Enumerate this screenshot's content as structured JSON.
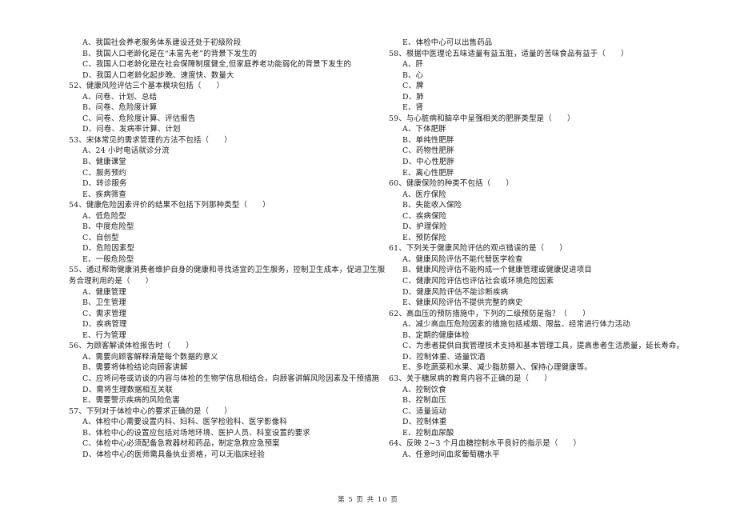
{
  "left_column": [
    {
      "type": "opt",
      "text": "A、我国社会养老服务体系建设还处于初级阶段"
    },
    {
      "type": "opt",
      "text": "B、我国人口老龄化是在“未富先老”的背景下发生的"
    },
    {
      "type": "opt",
      "text": "C、我国人口老龄化是在社会保障制度健全,但家庭养老功能弱化的背景下发生的"
    },
    {
      "type": "opt",
      "text": "D、我国人口老龄化起步晚、速度快、数量大"
    },
    {
      "type": "q",
      "text": "52、健康风险评估三个基本模块包括（　　）"
    },
    {
      "type": "opt",
      "text": "A、问卷、计划、总结"
    },
    {
      "type": "opt",
      "text": "B、问卷、危险度计算"
    },
    {
      "type": "opt",
      "text": "C、问卷、危险度计算、评估报告"
    },
    {
      "type": "opt",
      "text": "D、问卷、发病率计算、计划"
    },
    {
      "type": "q",
      "text": "53、宋体常见的需求管理的方法不包括（　　）"
    },
    {
      "type": "opt",
      "text": "A、24 小时电话就诊分流"
    },
    {
      "type": "opt",
      "text": "B、健康课堂"
    },
    {
      "type": "opt",
      "text": "C、服务预约"
    },
    {
      "type": "opt",
      "text": "D、转诊服务"
    },
    {
      "type": "opt",
      "text": "E、疾病筛查"
    },
    {
      "type": "q",
      "text": "54、健康危险因素评价的结果不包括下列那种类型（　　）"
    },
    {
      "type": "opt",
      "text": "A、低危险型"
    },
    {
      "type": "opt",
      "text": "B、中度危险型"
    },
    {
      "type": "opt",
      "text": "C、自创型"
    },
    {
      "type": "opt",
      "text": "D、危险因素型"
    },
    {
      "type": "opt",
      "text": "E、一般危险型"
    },
    {
      "type": "q",
      "text": "55、通过帮助健康消费者维护自身的健康和寻找适宜的卫生服务，控制卫生成本，促进卫生服"
    },
    {
      "type": "cont",
      "text": "务合理利用的是（　　）"
    },
    {
      "type": "opt",
      "text": "A、健康管理"
    },
    {
      "type": "opt",
      "text": "B、卫生管理"
    },
    {
      "type": "opt",
      "text": "C、需求管理"
    },
    {
      "type": "opt",
      "text": "D、疾病管理"
    },
    {
      "type": "opt",
      "text": "E、行为管理"
    },
    {
      "type": "q",
      "text": "56、为顾客解读体检报告时（　　）"
    },
    {
      "type": "opt",
      "text": "A、需要向顾客解释清楚每个数据的意义"
    },
    {
      "type": "opt",
      "text": "B、需要将体检结论向顾客讲解"
    },
    {
      "type": "opt",
      "text": "C、应将问卷或访谈的内容与体检的生物学信息相结合，向顾客讲解风险因素及干预措施"
    },
    {
      "type": "opt",
      "text": "D、需将生理数据相互关联"
    },
    {
      "type": "opt",
      "text": "E、需要警示疾病的风险危害"
    },
    {
      "type": "q",
      "text": "57、下列对于体检中心的要求正确的是（　　）"
    },
    {
      "type": "opt",
      "text": "A、体检中心需要设置内科、妇科、医学检验科、医学影像科"
    },
    {
      "type": "opt",
      "text": "B、体检中心的设置应包括对场地环境、医护人员、科室设置的要求"
    },
    {
      "type": "opt",
      "text": "C、体检中心必须配备急救器材和药品，制定急救应急预案"
    },
    {
      "type": "opt",
      "text": "D、体检中心的医师需具备执业资格，可以无临床经验"
    }
  ],
  "right_column": [
    {
      "type": "opt",
      "text": "E、体检中心可以出售药品"
    },
    {
      "type": "q",
      "text": "58、根据中医理论五味适量有益五脏，适量的苦味食品有益于（　　）"
    },
    {
      "type": "opt",
      "text": "A、肝"
    },
    {
      "type": "opt",
      "text": "B、心"
    },
    {
      "type": "opt",
      "text": "C、脾"
    },
    {
      "type": "opt",
      "text": "D、肺"
    },
    {
      "type": "opt",
      "text": "E、肾"
    },
    {
      "type": "q",
      "text": "59、与心脏病和脑卒中呈强相关的肥胖类型是（　　）"
    },
    {
      "type": "opt",
      "text": "A、下体肥胖"
    },
    {
      "type": "opt",
      "text": "B、单纯性肥胖"
    },
    {
      "type": "opt",
      "text": "C、药物性肥胖"
    },
    {
      "type": "opt",
      "text": "D、中心性肥胖"
    },
    {
      "type": "opt",
      "text": "E、离心性肥胖"
    },
    {
      "type": "q",
      "text": "60、健康保险的种类不包括（　　）"
    },
    {
      "type": "opt",
      "text": "A、医疗保险"
    },
    {
      "type": "opt",
      "text": "B、失能收入保险"
    },
    {
      "type": "opt",
      "text": "C、疾病保险"
    },
    {
      "type": "opt",
      "text": "D、护理保险"
    },
    {
      "type": "opt",
      "text": "E、预防保险"
    },
    {
      "type": "q",
      "text": "61、下列关于健康风险评估的观点错误的是（　　）"
    },
    {
      "type": "opt",
      "text": "A、健康风险评估不能代替医学检查"
    },
    {
      "type": "opt",
      "text": "B、健康风险评估不能构成一个健康管理或健康促进项目"
    },
    {
      "type": "opt",
      "text": "C、健康风险评估也评估社会或环境危险因素"
    },
    {
      "type": "opt",
      "text": "D、健康风险评估不能诊断疾病"
    },
    {
      "type": "opt",
      "text": "E、健康风险评估不提供完整的病史"
    },
    {
      "type": "q",
      "text": "62、高血压的预防措施中，下列的二级预防是指？（　　）"
    },
    {
      "type": "opt",
      "text": "A、减少高血压危险因素的措施包括戒烟、限盐、经常进行体力活动"
    },
    {
      "type": "opt",
      "text": "B、定期的健康体检"
    },
    {
      "type": "opt",
      "text": "C、为患者提供自我管理技术支持和基本管理工具，提高患者生活质量，延长寿命。"
    },
    {
      "type": "opt",
      "text": "D、控制体重、适量饮酒"
    },
    {
      "type": "opt",
      "text": "E、多吃蔬菜和水果、减少脂肪摄入、保持心理健康等。"
    },
    {
      "type": "q",
      "text": "63、关于糖尿病的教育内容不正确的是（　　）"
    },
    {
      "type": "opt",
      "text": "A、控制饮食"
    },
    {
      "type": "opt",
      "text": "B、控制血压"
    },
    {
      "type": "opt",
      "text": "C、适量运动"
    },
    {
      "type": "opt",
      "text": "D、控制体重"
    },
    {
      "type": "opt",
      "text": "E、控制血尿酸"
    },
    {
      "type": "q",
      "text": "64、反映 2~3 个月血糖控制水平良好的指示是（　　）"
    },
    {
      "type": "opt",
      "text": "A、任意时间血浆葡萄糖水平"
    }
  ],
  "footer": {
    "page_label": "第 5 页 共 10 页"
  }
}
